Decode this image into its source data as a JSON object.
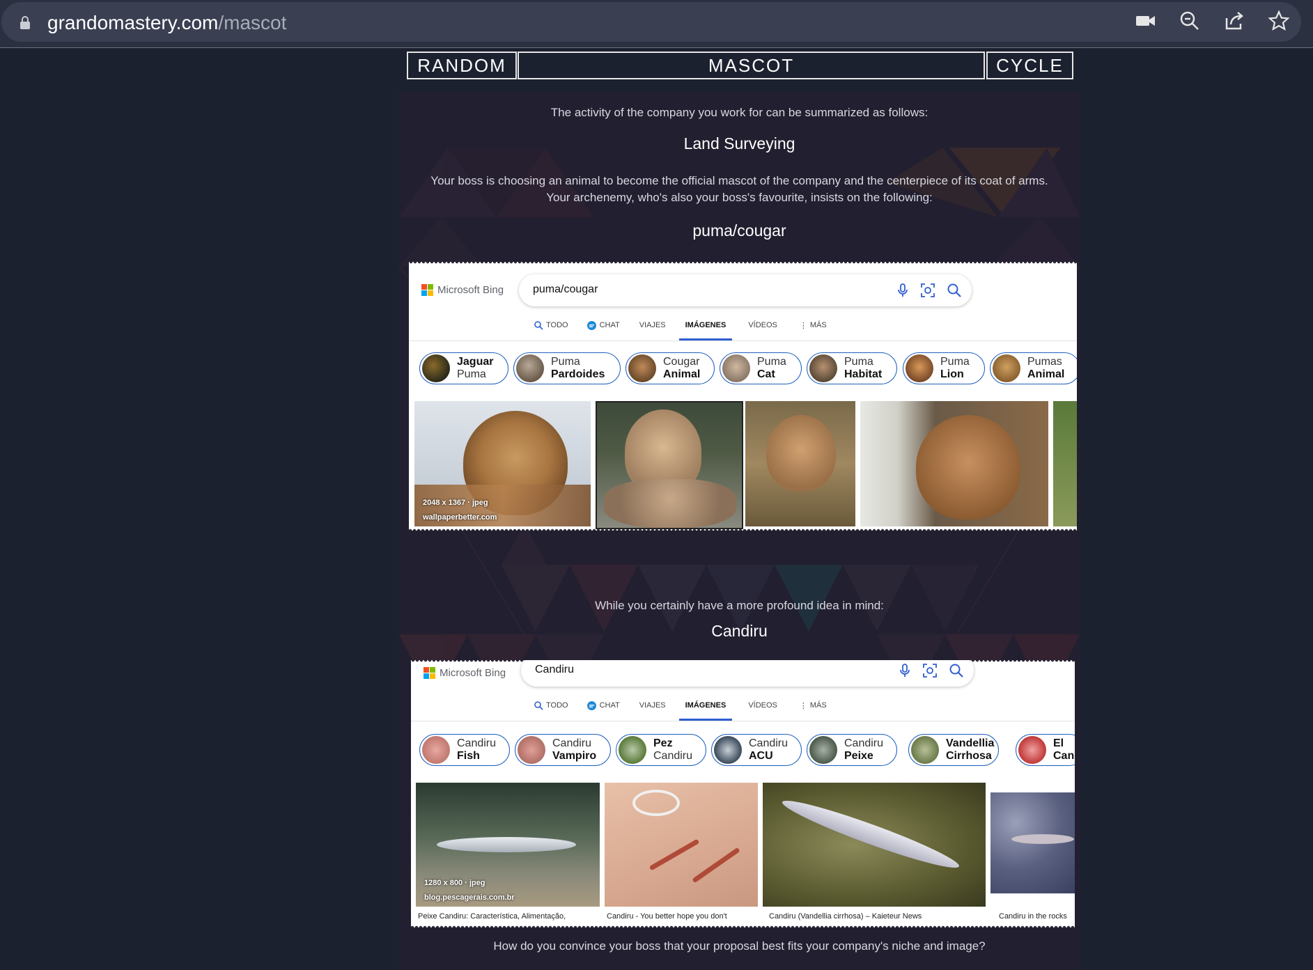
{
  "browser": {
    "domain": "grandomastery.com",
    "path": "/mascot"
  },
  "header": {
    "left": "RANDOM",
    "center": "MASCOT",
    "right": "CYCLE"
  },
  "intro": "The activity of the company you work for can be summarized as follows:",
  "activity": "Land Surveying",
  "boss_line1": "Your boss is choosing an animal to become the official mascot of the company and the centerpiece of its coat of arms.",
  "boss_line2": "Your archenemy, who's also your boss's favourite, insists on the following:",
  "archenemy_choice": "puma/cougar",
  "tabs": {
    "all": "TODO",
    "chat": "CHAT",
    "travel": "VIAJES",
    "images": "IMÁGENES",
    "videos": "VÍDEOS",
    "more": "MÁS"
  },
  "bing_logo": "Microsoft Bing",
  "search1": {
    "query": "puma/cougar",
    "chips": [
      {
        "top": "Jaguar",
        "bottom": "Puma"
      },
      {
        "top": "Puma",
        "bottom": "Pardoides"
      },
      {
        "top": "Cougar",
        "bottom": "Animal"
      },
      {
        "top": "Puma",
        "bottom": "Cat"
      },
      {
        "top": "Puma",
        "bottom": "Habitat"
      },
      {
        "top": "Puma",
        "bottom": "Lion"
      },
      {
        "top": "Pumas",
        "bottom": "Animal"
      }
    ],
    "first_meta": "2048 x 1367 · jpeg",
    "first_source": "wallpaperbetter.com"
  },
  "your_idea_line": "While you certainly have a more profound idea in mind:",
  "your_choice": "Candiru",
  "search2": {
    "query": "Candiru",
    "chips": [
      {
        "top": "Candiru",
        "bottom": "Fish"
      },
      {
        "top": "Candiru",
        "bottom": "Vampiro"
      },
      {
        "top": "Pez",
        "bottom": "Candiru"
      },
      {
        "top": "Candiru",
        "bottom": "ACU"
      },
      {
        "top": "Candiru",
        "bottom": "Peixe"
      },
      {
        "top": "Vandellia",
        "bottom": "Cirrhosa"
      },
      {
        "top": "El",
        "bottom": "Can"
      }
    ],
    "first_meta": "1280 x 800 · jpeg",
    "first_source": "blog.pescagerais.com.br",
    "captions": [
      "Peixe Candiru: Característica, Alimentação,",
      "Candiru - You better hope you don't",
      "Candiru (Vandellia cirrhosa) – Kaieteur News",
      "Candiru in the rocks"
    ]
  },
  "question": "How do you convince your boss that your proposal best fits your company's niche and image?"
}
